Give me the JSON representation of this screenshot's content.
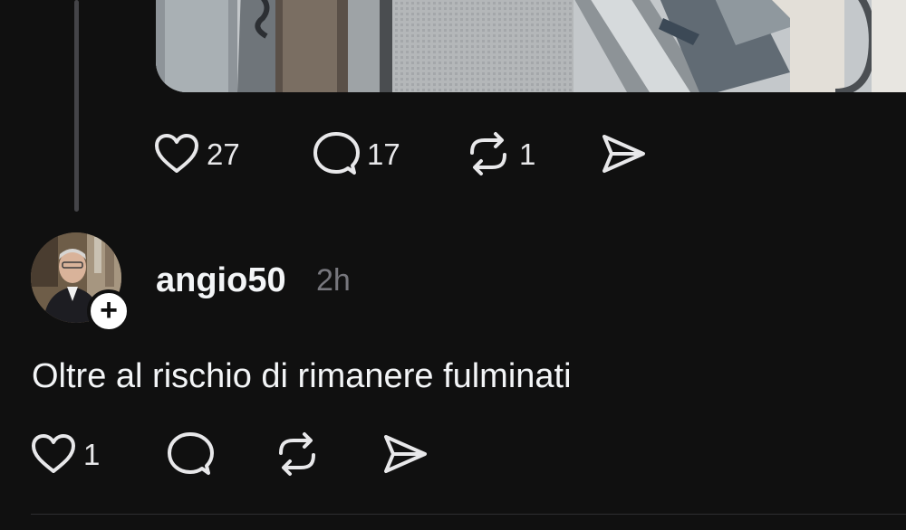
{
  "previous_post": {
    "likes": "27",
    "replies": "17",
    "reposts": "1"
  },
  "reply_post": {
    "username": "angio50",
    "timestamp": "2h",
    "text": "Oltre al rischio di rimanere fulminati",
    "likes": "1"
  },
  "icons": {
    "like": "heart-icon",
    "reply": "speech-bubble-icon",
    "repost": "repost-arrows-icon",
    "share": "send-icon",
    "follow": "plus-icon"
  },
  "colors": {
    "background": "#101010",
    "text": "#f3f5f7",
    "muted": "#77777d",
    "icon": "#e8e8ea"
  }
}
